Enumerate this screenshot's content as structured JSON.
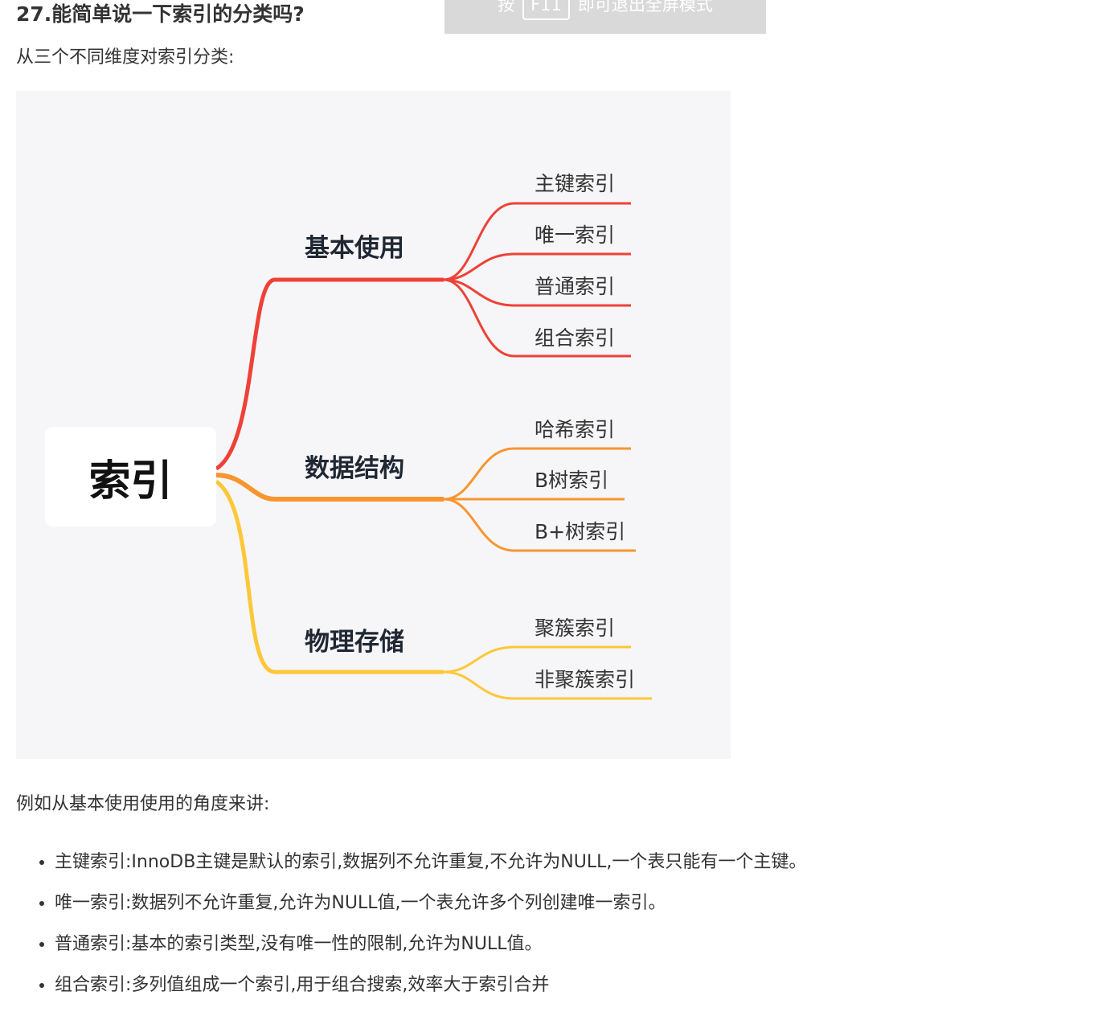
{
  "article": {
    "title": "27.能简单说一下索引的分类吗?",
    "intro": "从三个不同维度对索引分类:",
    "example_intro": "例如从基本使用使用的角度来讲:"
  },
  "fullscreen_hint": {
    "prefix": "按",
    "key": "F11",
    "suffix": "即可退出全屏模式"
  },
  "mindmap": {
    "root": "索引",
    "branches": [
      {
        "label": "基本使用",
        "color": "#ef4136",
        "leaves": [
          "主键索引",
          "唯一索引",
          "普通索引",
          "组合索引"
        ]
      },
      {
        "label": "数据结构",
        "color": "#f7962f",
        "leaves": [
          "哈希索引",
          "B树索引",
          "B+树索引"
        ]
      },
      {
        "label": "物理存储",
        "color": "#fdc738",
        "leaves": [
          "聚簇索引",
          "非聚簇索引"
        ]
      }
    ]
  },
  "bullets": [
    "主键索引:InnoDB主键是默认的索引,数据列不允许重复,不允许为NULL,一个表只能有一个主键。",
    "唯一索引:数据列不允许重复,允许为NULL值,一个表允许多个列创建唯一索引。",
    "普通索引:基本的索引类型,没有唯一性的限制,允许为NULL值。",
    "组合索引:多列值组成一个索引,用于组合搜索,效率大于索引合并"
  ]
}
